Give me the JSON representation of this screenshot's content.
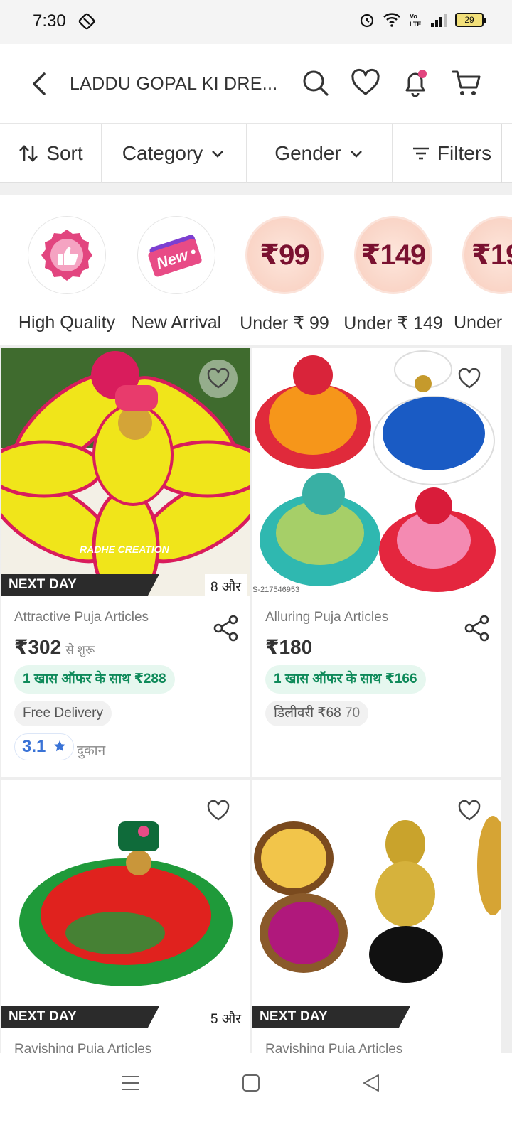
{
  "status_bar": {
    "time": "7:30",
    "battery": "29"
  },
  "header": {
    "title": "LADDU GOPAL KI DRE..."
  },
  "filters": {
    "sort": "Sort",
    "category": "Category",
    "gender": "Gender",
    "filters": "Filters"
  },
  "categories": [
    {
      "label": "High Quality",
      "icon": "thumbs-up-badge-icon"
    },
    {
      "label": "New Arrival",
      "icon": "new-tag-icon",
      "badge_text": "New"
    },
    {
      "label": "Under ₹ 99",
      "price": "₹99"
    },
    {
      "label": "Under ₹ 149",
      "price": "₹149"
    },
    {
      "label": "Under",
      "price": "₹19"
    }
  ],
  "products": [
    {
      "dispatch": "NEXT DAY DISPATCH",
      "more": "8 और",
      "image_text": "RADHE CREATION",
      "name": "Attractive Puja Articles",
      "price": "₹302",
      "price_suffix": "से शुरू",
      "offer": "1 खास ऑफर के साथ ₹288",
      "delivery": "Free Delivery",
      "rating": "3.1",
      "shop": "दुकान"
    },
    {
      "sku": "S-217546953",
      "name": "Alluring Puja Articles",
      "price": "₹180",
      "offer": "1 खास ऑफर के साथ ₹166",
      "delivery_label": "डिलीवरी ₹68",
      "delivery_strike": "70"
    },
    {
      "dispatch": "NEXT DAY DISPATCH",
      "more": "5 और",
      "name": "Ravishing Puja Articles"
    },
    {
      "dispatch": "NEXT DAY DISPATCH",
      "name": "Ravishing Puja Articles"
    }
  ],
  "colors": {
    "accent_pink": "#e2457f",
    "offer_green": "#0f8a5a",
    "rating_blue": "#3a73d6"
  }
}
